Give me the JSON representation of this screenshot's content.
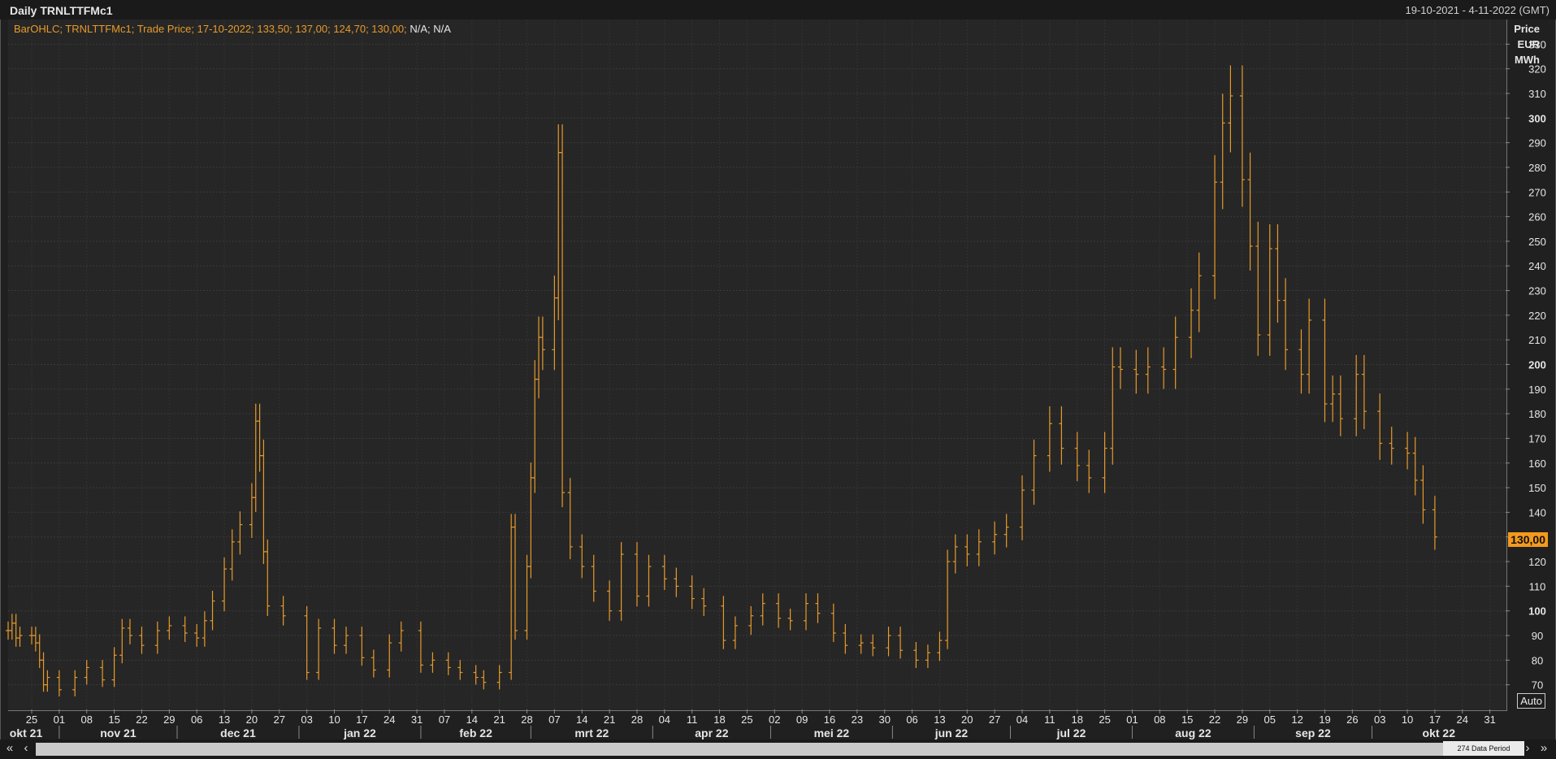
{
  "window": {
    "title": "Daily TRNLTTFMc1",
    "range": "19-10-2021 - 4-11-2022 (GMT)"
  },
  "legend": {
    "text": "BarOHLC; TRNLTTFMc1; Trade Price; 17-10-2022; 133,50; 137,00; 124,70; 130,00;",
    "na": "N/A; N/A"
  },
  "yaxis_title": [
    "Price",
    "EUR",
    "MWh"
  ],
  "last_price_label": "130,00",
  "auto_label": "Auto",
  "data_period_label": "274 Data Period",
  "colors": {
    "bars": "#e79a2a",
    "background": "#262626",
    "grid": "#3a3a3a",
    "last_price": "#f39a1d"
  },
  "chart_data": {
    "type": "bar",
    "style": "OHLC",
    "title": "Daily TRNLTTFMc1",
    "ylabel": "Price EUR MWh",
    "ylim": [
      60,
      340
    ],
    "yticks": [
      70,
      80,
      90,
      100,
      110,
      120,
      130,
      140,
      150,
      160,
      170,
      180,
      190,
      200,
      210,
      220,
      230,
      240,
      250,
      260,
      270,
      280,
      290,
      300,
      310,
      320,
      330
    ],
    "ytick_bold": [
      100,
      200,
      300
    ],
    "grid": true,
    "xlim": [
      "2021-10-19",
      "2022-11-04"
    ],
    "xtick_labels": [
      "25",
      "01",
      "08",
      "15",
      "22",
      "29",
      "06",
      "13",
      "20",
      "27",
      "03",
      "10",
      "17",
      "24",
      "31",
      "07",
      "14",
      "21",
      "28",
      "07",
      "14",
      "21",
      "28",
      "04",
      "11",
      "18",
      "25",
      "02",
      "09",
      "16",
      "23",
      "30",
      "06",
      "13",
      "20",
      "27",
      "04",
      "11",
      "18",
      "25",
      "01",
      "08",
      "15",
      "22",
      "29",
      "05",
      "12",
      "19",
      "26",
      "03",
      "10",
      "17",
      "24",
      "31"
    ],
    "month_labels": [
      "okt 21",
      "nov 21",
      "dec 21",
      "jan 22",
      "feb 22",
      "mrt 22",
      "apr 22",
      "mei 22",
      "jun 22",
      "jul 22",
      "aug 22",
      "sep 22",
      "okt 22"
    ],
    "bars_close_approx": {
      "2021-10-19": 92,
      "2021-10-20": 95,
      "2021-10-21": 89,
      "2021-10-22": 90,
      "2021-10-25": 90,
      "2021-10-26": 87,
      "2021-10-27": 80,
      "2021-10-28": 70,
      "2021-10-29": 73,
      "2021-11-01": 68,
      "2021-11-05": 73,
      "2021-11-08": 77,
      "2021-11-12": 72,
      "2021-11-15": 82,
      "2021-11-17": 93,
      "2021-11-19": 90,
      "2021-11-22": 86,
      "2021-11-26": 92,
      "2021-11-29": 94,
      "2021-12-03": 91,
      "2021-12-06": 89,
      "2021-12-08": 96,
      "2021-12-10": 104,
      "2021-12-13": 117,
      "2021-12-15": 128,
      "2021-12-17": 135,
      "2021-12-20": 146,
      "2021-12-21": 177,
      "2021-12-22": 163,
      "2021-12-23": 124,
      "2021-12-24": 102,
      "2021-12-28": 98,
      "2022-01-03": 75,
      "2022-01-06": 93,
      "2022-01-10": 86,
      "2022-01-13": 90,
      "2022-01-17": 81,
      "2022-01-20": 76,
      "2022-01-24": 87,
      "2022-01-27": 92,
      "2022-02-01": 78,
      "2022-02-04": 80,
      "2022-02-08": 77,
      "2022-02-11": 75,
      "2022-02-15": 73,
      "2022-02-17": 71,
      "2022-02-21": 75,
      "2022-02-24": 134,
      "2022-02-25": 92,
      "2022-02-28": 118,
      "2022-03-01": 154,
      "2022-03-02": 194,
      "2022-03-03": 211,
      "2022-03-04": 206,
      "2022-03-07": 227,
      "2022-03-08": 286,
      "2022-03-09": 148,
      "2022-03-11": 126,
      "2022-03-14": 118,
      "2022-03-17": 108,
      "2022-03-21": 100,
      "2022-03-24": 123,
      "2022-03-28": 106,
      "2022-03-31": 118,
      "2022-04-04": 113,
      "2022-04-07": 110,
      "2022-04-11": 105,
      "2022-04-14": 102,
      "2022-04-19": 88,
      "2022-04-22": 94,
      "2022-04-26": 98,
      "2022-04-29": 103,
      "2022-05-03": 97,
      "2022-05-06": 96,
      "2022-05-10": 103,
      "2022-05-13": 99,
      "2022-05-17": 91,
      "2022-05-20": 86,
      "2022-05-24": 87,
      "2022-05-27": 85,
      "2022-05-31": 90,
      "2022-06-03": 84,
      "2022-06-07": 80,
      "2022-06-10": 83,
      "2022-06-13": 88,
      "2022-06-15": 120,
      "2022-06-17": 126,
      "2022-06-20": 123,
      "2022-06-23": 128,
      "2022-06-27": 131,
      "2022-06-30": 134,
      "2022-07-04": 149,
      "2022-07-07": 163,
      "2022-07-11": 176,
      "2022-07-14": 166,
      "2022-07-18": 159,
      "2022-07-21": 154,
      "2022-07-25": 166,
      "2022-07-27": 199,
      "2022-07-29": 198,
      "2022-08-02": 196,
      "2022-08-05": 199,
      "2022-08-09": 198,
      "2022-08-12": 211,
      "2022-08-16": 222,
      "2022-08-18": 236,
      "2022-08-22": 274,
      "2022-08-24": 298,
      "2022-08-26": 309,
      "2022-08-29": 275,
      "2022-08-31": 248,
      "2022-09-02": 212,
      "2022-09-05": 247,
      "2022-09-07": 226,
      "2022-09-09": 206,
      "2022-09-13": 196,
      "2022-09-15": 218,
      "2022-09-19": 184,
      "2022-09-21": 188,
      "2022-09-23": 178,
      "2022-09-27": 196,
      "2022-09-29": 181,
      "2022-10-03": 168,
      "2022-10-06": 166,
      "2022-10-10": 164,
      "2022-10-12": 153,
      "2022-10-14": 141,
      "2022-10-17": 130
    }
  }
}
